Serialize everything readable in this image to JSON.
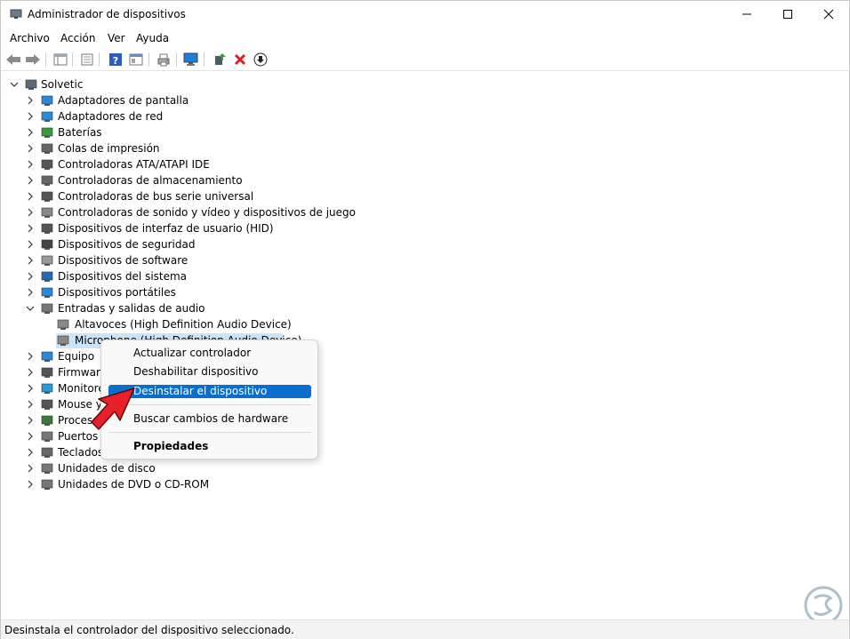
{
  "window": {
    "title": "Administrador de dispositivos"
  },
  "menu": [
    "Archivo",
    "Acción",
    "Ver",
    "Ayuda"
  ],
  "tree": {
    "root": "Solvetic",
    "items": [
      "Adaptadores de pantalla",
      "Adaptadores de red",
      "Baterías",
      "Colas de impresión",
      "Controladoras ATA/ATAPI IDE",
      "Controladoras de almacenamiento",
      "Controladoras de bus serie universal",
      "Controladoras de sonido y vídeo y dispositivos de juego",
      "Dispositivos de interfaz de usuario (HID)",
      "Dispositivos de seguridad",
      "Dispositivos de software",
      "Dispositivos del sistema",
      "Dispositivos portátiles",
      "Entradas y salidas de audio"
    ],
    "audio_children": [
      "Altavoces (High Definition Audio Device)",
      "Microphone (High Definition Audio Device)"
    ],
    "items_after": [
      "Equipo",
      "Firmware",
      "Monitores",
      "Mouse y otros dispositivos señaladores",
      "Procesadores",
      "Puertos (COM y LPT)",
      "Teclados",
      "Unidades de disco",
      "Unidades de DVD o CD-ROM"
    ]
  },
  "context_menu": {
    "items": [
      "Actualizar controlador",
      "Deshabilitar dispositivo",
      "Desinstalar el dispositivo",
      "Buscar cambios de hardware",
      "Propiedades"
    ]
  },
  "status": "Desinstala el controlador del dispositivo seleccionado.",
  "colors": {
    "highlight": "#0a6ecf",
    "selection": "#cce4f7",
    "arrow": "#e8202a"
  },
  "watermark_text": "SOLVETIC"
}
